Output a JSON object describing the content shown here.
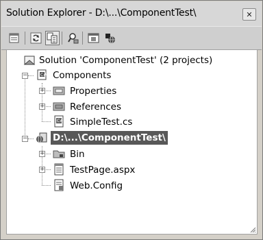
{
  "window": {
    "title": "Solution Explorer - D:\\...\\ComponentTest\\",
    "close_glyph": "✕"
  },
  "toolbar": {
    "buttons": [
      {
        "name": "properties-icon"
      },
      {
        "name": "refresh-icon"
      },
      {
        "name": "show-all-files-icon",
        "pressed": true
      },
      {
        "name": "find-icon"
      },
      {
        "name": "view-designer-icon"
      },
      {
        "name": "copy-website-icon"
      }
    ]
  },
  "tree": {
    "solution": "Solution 'ComponentTest' (2 projects)",
    "components": "Components",
    "properties": "Properties",
    "references": "References",
    "simpletest": "SimpleTest.cs",
    "website": "D:\\...\\ComponentTest\\",
    "bin": "Bin",
    "testpage": "TestPage.aspx",
    "webconfig": "Web.Config",
    "expand_plus": "+",
    "expand_minus": "−"
  }
}
